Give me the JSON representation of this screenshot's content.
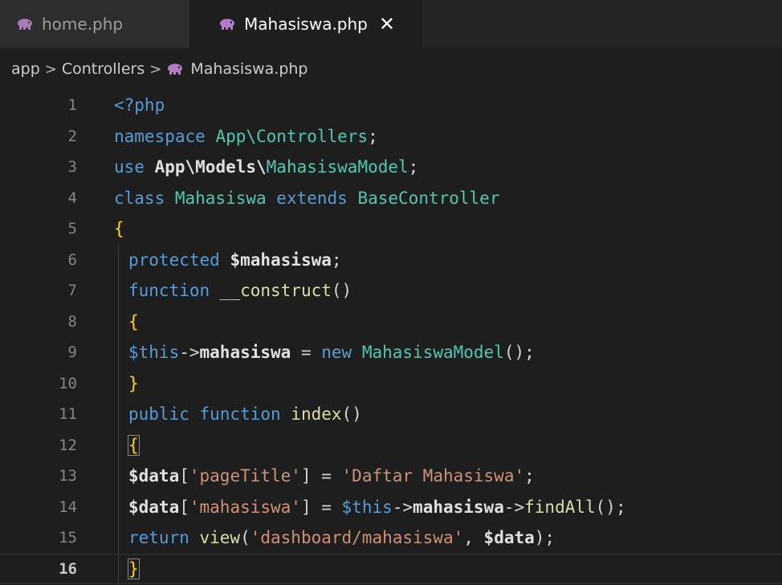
{
  "tabs": [
    {
      "label": "home.php",
      "active": false,
      "icon": "php-elephant-icon"
    },
    {
      "label": "Mahasiswa.php",
      "active": true,
      "icon": "php-elephant-icon",
      "close_glyph": "✕"
    }
  ],
  "breadcrumb": [
    "app",
    "Controllers",
    "Mahasiswa.php"
  ],
  "breadcrumb_separator": ">",
  "line_numbers": [
    "1",
    "2",
    "3",
    "4",
    "5",
    "6",
    "7",
    "8",
    "9",
    "10",
    "11",
    "12",
    "13",
    "14",
    "15",
    "16"
  ],
  "active_line": "16",
  "code": {
    "l1": {
      "a": "<?php"
    },
    "l2": {
      "a": "namespace",
      "b": " App\\Controllers",
      "c": ";"
    },
    "l3": {
      "a": "use",
      "b": " App\\Models\\",
      "c": "MahasiswaModel",
      "d": ";"
    },
    "l4": {
      "a": "class",
      "b": " Mahasiswa ",
      "c": "extends",
      "d": " BaseController"
    },
    "l5": {
      "a": "{"
    },
    "l6": {
      "a": "protected",
      "b": " $mahasiswa",
      "c": ";"
    },
    "l7": {
      "a": "function",
      "b": " __construct",
      "c": "()"
    },
    "l8": {
      "a": "{"
    },
    "l9": {
      "a": "$this",
      "b": "->",
      "c": "mahasiswa",
      "d": " = ",
      "e": "new",
      "f": " MahasiswaModel",
      "g": "();"
    },
    "l10": {
      "a": "}"
    },
    "l11": {
      "a": "public",
      "b": " function",
      "c": " index",
      "d": "()"
    },
    "l12": {
      "a": "{"
    },
    "l13": {
      "a": "$data",
      "b": "[",
      "c": "'pageTitle'",
      "d": "] = ",
      "e": "'Daftar Mahasiswa'",
      "f": ";"
    },
    "l14": {
      "a": "$data",
      "b": "[",
      "c": "'mahasiswa'",
      "d": "] = ",
      "e": "$this",
      "f": "->",
      "g": "mahasiswa",
      "h": "->",
      "i": "findAll",
      "j": "();"
    },
    "l15": {
      "a": "return",
      "b": " view",
      "c": "(",
      "d": "'dashboard/mahasiswa'",
      "e": ", ",
      "f": "$data",
      "g": ");"
    },
    "l16": {
      "a": "}"
    }
  },
  "colors": {
    "background": "#1e1e1e",
    "tabbar": "#252526",
    "keyword": "#569cd6",
    "class": "#4ec9b0",
    "variable": "#9cdcfe",
    "function": "#dcdcaa",
    "string": "#ce9178",
    "php_icon": "#b07cc6"
  }
}
